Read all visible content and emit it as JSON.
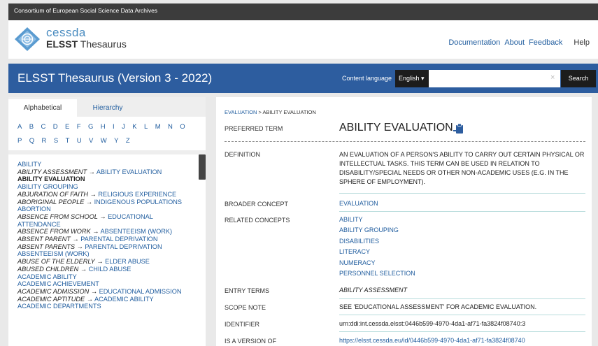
{
  "topbar": {
    "text": "Consortium of European Social Science Data Archives"
  },
  "header": {
    "logo_small": "cessda",
    "logo_bold": "ELSST",
    "logo_rest": " Thesaurus",
    "nav": {
      "documentation": "Documentation",
      "about": "About",
      "feedback": "Feedback",
      "help": "Help"
    }
  },
  "bluebar": {
    "title": "ELSST Thesaurus (Version 3 - 2022)",
    "content_language_label": "Content language",
    "language": "English",
    "caret": "▾",
    "search_value": "",
    "clear": "×",
    "search_button": "Search"
  },
  "sidebar": {
    "tabs": {
      "alphabetical": "Alphabetical",
      "hierarchy": "Hierarchy"
    },
    "letters_row1": [
      "A",
      "B",
      "C",
      "D",
      "E",
      "F",
      "G",
      "H",
      "I",
      "J",
      "K",
      "L",
      "M",
      "N",
      "O"
    ],
    "letters_row2": [
      "P",
      "Q",
      "R",
      "S",
      "T",
      "U",
      "V",
      "W",
      "Y",
      "Z"
    ],
    "terms": [
      {
        "label": "ABILITY"
      },
      {
        "entry": "ABILITY ASSESSMENT",
        "arrow": " → ",
        "label": "ABILITY EVALUATION"
      },
      {
        "label": "ABILITY EVALUATION",
        "current": true
      },
      {
        "label": "ABILITY GROUPING"
      },
      {
        "entry": "ABJURATION OF FAITH",
        "arrow": " → ",
        "label": "RELIGIOUS EXPERIENCE"
      },
      {
        "entry": "ABORIGINAL PEOPLE",
        "arrow": " → ",
        "label": "INDIGENOUS POPULATIONS"
      },
      {
        "label": "ABORTION"
      },
      {
        "entry": "ABSENCE FROM SCHOOL",
        "arrow": " → ",
        "label": "EDUCATIONAL ATTENDANCE",
        "wrap": true
      },
      {
        "entry": "ABSENCE FROM WORK",
        "arrow": " → ",
        "label": "ABSENTEEISM (WORK)"
      },
      {
        "entry": "ABSENT PARENT",
        "arrow": " → ",
        "label": "PARENTAL DEPRIVATION"
      },
      {
        "entry": "ABSENT PARENTS",
        "arrow": " → ",
        "label": "PARENTAL DEPRIVATION"
      },
      {
        "label": "ABSENTEEISM (WORK)"
      },
      {
        "entry": "ABUSE OF THE ELDERLY",
        "arrow": " → ",
        "label": "ELDER ABUSE"
      },
      {
        "entry": "ABUSED CHILDREN",
        "arrow": " → ",
        "label": "CHILD ABUSE"
      },
      {
        "label": "ACADEMIC ABILITY"
      },
      {
        "label": "ACADEMIC ACHIEVEMENT"
      },
      {
        "entry": "ACADEMIC ADMISSION",
        "arrow": " → ",
        "label": "EDUCATIONAL ADMISSION"
      },
      {
        "entry": "ACADEMIC APTITUDE",
        "arrow": " → ",
        "label": "ACADEMIC ABILITY"
      },
      {
        "label": "ACADEMIC DEPARTMENTS"
      }
    ]
  },
  "concept": {
    "breadcrumb_parent": "EVALUATION",
    "breadcrumb_sep": " > ",
    "breadcrumb_current": "ABILITY EVALUATION",
    "labels": {
      "preferred": "PREFERRED TERM",
      "definition": "DEFINITION",
      "broader": "BROADER CONCEPT",
      "related": "RELATED CONCEPTS",
      "entry_terms": "ENTRY TERMS",
      "scope": "SCOPE NOTE",
      "identifier": "IDENTIFIER",
      "version_of": "IS A VERSION OF"
    },
    "preferred_term": "ABILITY EVALUATION",
    "definition": "AN EVALUATION OF A PERSON'S ABILITY TO CARRY OUT CERTAIN PHYSICAL OR INTELLECTUAL TASKS. THIS TERM CAN BE USED IN RELATION TO DISABILITY/SPECIAL NEEDS OR OTHER NON-ACADEMIC USES (E.G. IN THE SPHERE OF EMPLOYMENT).",
    "broader_concept": "EVALUATION",
    "related_concepts": [
      "ABILITY",
      "ABILITY GROUPING",
      "DISABILITIES",
      "LITERACY",
      "NUMERACY",
      "PERSONNEL SELECTION"
    ],
    "entry_terms": "ABILITY ASSESSMENT",
    "scope_note": "SEE 'EDUCATIONAL ASSESSMENT' FOR ACADEMIC EVALUATION.",
    "identifier": "urn:ddi:int.cessda.elsst:0446b599-4970-4da1-af71-fa3824f08740:3",
    "version_of": "https://elsst.cessda.eu/id/0446b599-4970-4da1-af71-fa3824f08740"
  },
  "colors": {
    "brand_blue": "#2d5d9f",
    "link": "#1f5c9e",
    "dark": "#1c1c1c"
  }
}
